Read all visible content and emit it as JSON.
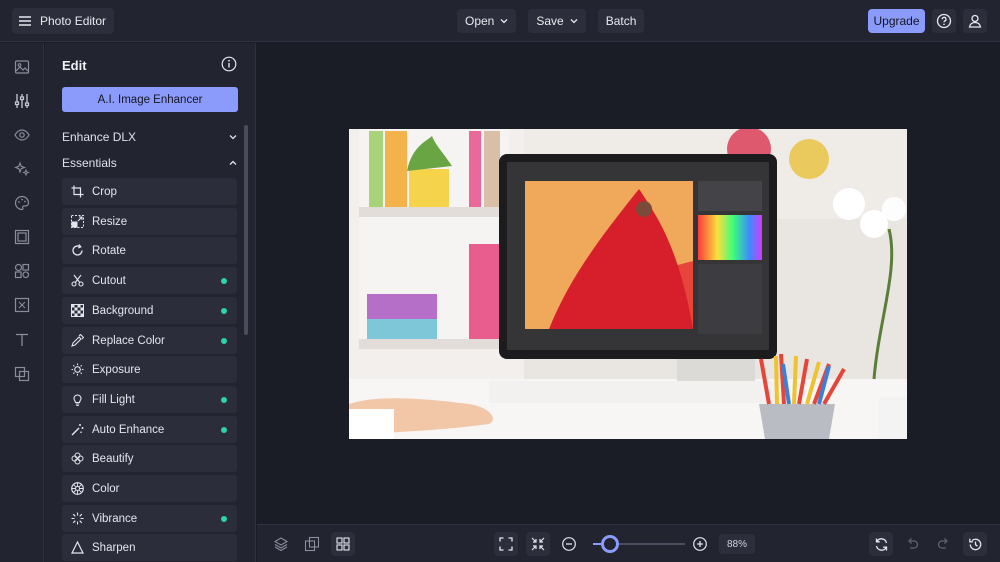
{
  "header": {
    "app_title": "Photo Editor",
    "open_label": "Open",
    "save_label": "Save",
    "batch_label": "Batch",
    "upgrade_label": "Upgrade"
  },
  "rail": {
    "icons": [
      "image-icon",
      "sliders-icon",
      "eye-icon",
      "sparkles-icon",
      "palette-icon",
      "frame-icon",
      "elements-icon",
      "texture-icon",
      "text-icon",
      "overlay-icon"
    ]
  },
  "panel": {
    "title": "Edit",
    "ai_button": "A.I. Image Enhancer",
    "sections": [
      {
        "label": "Enhance DLX",
        "state": "collapsed"
      },
      {
        "label": "Essentials",
        "state": "expanded"
      }
    ],
    "tools": [
      {
        "label": "Crop",
        "icon": "crop-icon",
        "badge": false
      },
      {
        "label": "Resize",
        "icon": "resize-icon",
        "badge": false
      },
      {
        "label": "Rotate",
        "icon": "rotate-icon",
        "badge": false
      },
      {
        "label": "Cutout",
        "icon": "scissors-icon",
        "badge": true
      },
      {
        "label": "Background",
        "icon": "checkerboard-icon",
        "badge": true
      },
      {
        "label": "Replace Color",
        "icon": "dropper-icon",
        "badge": true
      },
      {
        "label": "Exposure",
        "icon": "sun-icon",
        "badge": false
      },
      {
        "label": "Fill Light",
        "icon": "bulb-icon",
        "badge": true
      },
      {
        "label": "Auto Enhance",
        "icon": "magic-wand-icon",
        "badge": true
      },
      {
        "label": "Beautify",
        "icon": "flower-icon",
        "badge": false
      },
      {
        "label": "Color",
        "icon": "color-wheel-icon",
        "badge": false
      },
      {
        "label": "Vibrance",
        "icon": "vibrance-icon",
        "badge": true
      },
      {
        "label": "Sharpen",
        "icon": "triangle-icon",
        "badge": false
      }
    ],
    "badge_color": "#2ed3a5"
  },
  "bottom": {
    "zoom_value": "88%",
    "zoom_slider_level": 0.18
  },
  "colors": {
    "accent": "#8b9bfb",
    "background": "#1b1d26",
    "panel": "#22242f"
  }
}
